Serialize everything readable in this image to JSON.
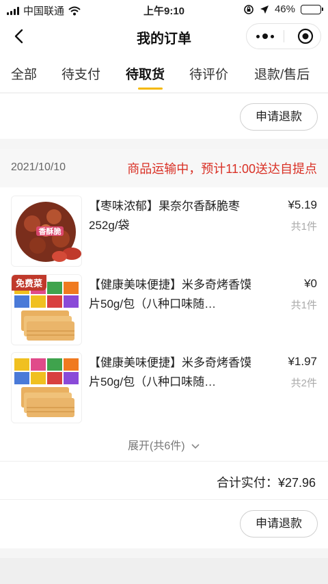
{
  "status_bar": {
    "carrier": "中国联通",
    "time": "上午9:10",
    "battery": "46%",
    "battery_level": 0.46
  },
  "nav": {
    "title": "我的订单"
  },
  "tabs": [
    {
      "label": "全部"
    },
    {
      "label": "待支付"
    },
    {
      "label": "待取货",
      "active": true
    },
    {
      "label": "待评价"
    },
    {
      "label": "退款/售后"
    }
  ],
  "prev_order": {
    "refund_label": "申请退款"
  },
  "order": {
    "date": "2021/10/10",
    "status": "商品运输中，预计11:00送达自提点",
    "items": [
      {
        "name": "【枣味浓郁】果奈尔香酥脆枣252g/袋",
        "price": "¥5.19",
        "qty": "共1件",
        "thumb_text": "香酥脆",
        "badge": ""
      },
      {
        "name": "【健康美味便捷】米多奇烤香馍片50g/包（八种口味随…",
        "price": "¥0",
        "qty": "共1件",
        "badge": "免费菜"
      },
      {
        "name": "【健康美味便捷】米多奇烤香馍片50g/包（八种口味随…",
        "price": "¥1.97",
        "qty": "共2件",
        "badge": ""
      }
    ],
    "expand_label": "展开(共6件)",
    "total_label": "合计实付：",
    "total_value": "¥27.96",
    "refund_label": "申请退款"
  },
  "colors": {
    "accent": "#f5b800",
    "status_red": "#d93025"
  }
}
